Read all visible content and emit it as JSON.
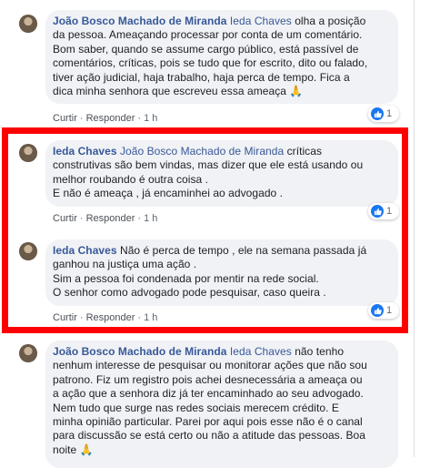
{
  "actions": {
    "like": "Curtir",
    "reply": "Responder",
    "time": "1 h",
    "dot": "·"
  },
  "reaction_count": "1",
  "comments": [
    {
      "author": "João Bosco Machado de Miranda",
      "tag": "Ieda Chaves",
      "lines": [
        " olha a posição",
        "da pessoa. Ameaçando processar por conta de um comentário.",
        "Bom saber, quando se assume cargo público, está passível de",
        "comentários, críticas, pois se tudo que for escrito, dito ou falado,",
        "tiver ação judicial, haja trabalho, haja perca de tempo. Fica a",
        "dica minha senhora que escreveu essa ameaça 🙏"
      ]
    },
    {
      "author": "Ieda Chaves",
      "tag": "João Bosco Machado de Miranda",
      "lines": [
        " críticas",
        "construtivas são bem vindas, mas dizer que ele está usando ou",
        "melhor roubando é outra coisa .",
        "E não é ameaça , já encaminhei ao advogado ."
      ]
    },
    {
      "author": "Ieda Chaves",
      "tag": "",
      "lines": [
        " Não é perca de tempo , ele na semana passada já",
        "ganhou na justiça uma ação .",
        "Sim a pessoa foi condenada por mentir na rede social.",
        "O senhor como advogado pode pesquisar, caso queira ."
      ]
    },
    {
      "author": "João Bosco Machado de Miranda",
      "tag": "Ieda Chaves",
      "lines": [
        " não tenho",
        "nenhum interesse de pesquisar ou monitorar ações que não sou",
        "patrono. Fiz um registro pois achei desnecessária a ameaça ou",
        "a ação que a senhora diz já ter encaminhado ao seu advogado.",
        "Nem tudo que surge nas redes sociais merecem crédito. E",
        "minha opinião particular. Parei por aqui pois esse não é o canal",
        "para discussão se está certo ou não a atitude das pessoas. Boa",
        "noite 🙏"
      ]
    }
  ]
}
